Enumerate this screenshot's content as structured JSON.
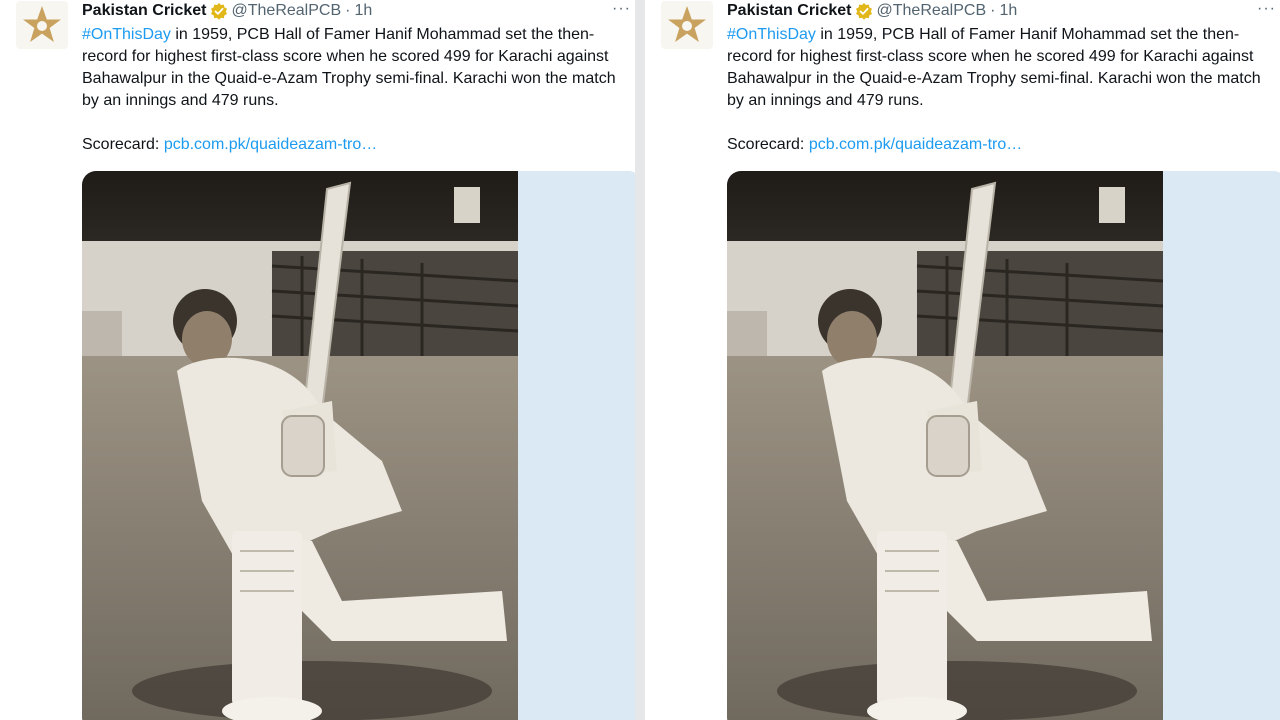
{
  "tweet": {
    "author_name": "Pakistan Cricket",
    "handle": "@TheRealPCB",
    "separator": "·",
    "time": "1h",
    "more_label": "···",
    "hashtag": "#OnThisDay",
    "line1_rest": " in 1959, PCB Hall of Famer Hanif Mohammad set the then-",
    "line2": "record for highest first-class score when he scored 499 for Karachi against",
    "line3": "Bahawalpur in the Quaid-e-Azam Trophy semi-final. Karachi won the match",
    "line4": "by an innings and 479 runs.",
    "scorecard_label": "Scorecard: ",
    "scorecard_link": "pcb.com.pk/quaideazam-tro…"
  },
  "colors": {
    "link": "#1d9bf0",
    "text": "#0f1419",
    "muted": "#536471",
    "verified_badge": "#e2b719",
    "logo_star": "#c8a25e"
  },
  "icons": {
    "avatar": "pcb-star-logo",
    "verified": "verified-badge-icon",
    "more": "more-options-icon"
  }
}
